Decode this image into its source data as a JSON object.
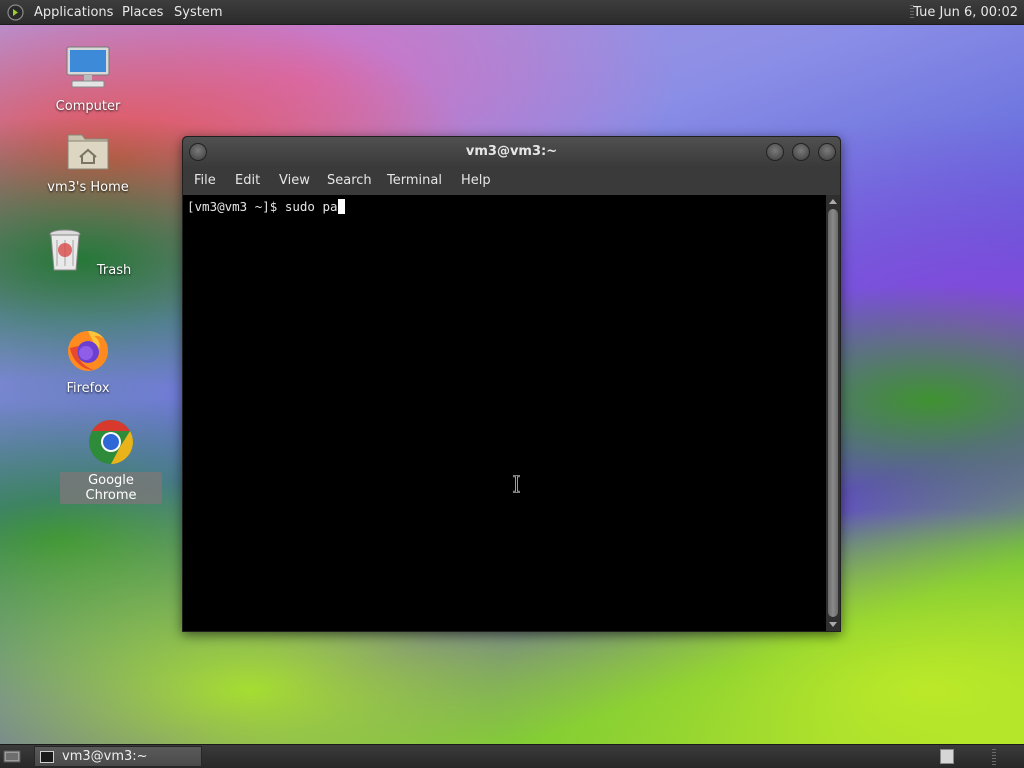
{
  "top_panel": {
    "menus": [
      "Applications",
      "Places",
      "System"
    ],
    "clock": "Tue Jun  6, 00:02"
  },
  "desktop": {
    "icons": [
      {
        "label": "Computer",
        "icon": "computer-icon"
      },
      {
        "label": "vm3's Home",
        "icon": "home-folder-icon"
      },
      {
        "label": "Trash",
        "icon": "trash-icon"
      },
      {
        "label": "Firefox",
        "icon": "firefox-icon"
      },
      {
        "label": "Google Chrome",
        "icon": "chrome-icon",
        "selected": true
      }
    ]
  },
  "terminal": {
    "title": "vm3@vm3:~",
    "menu": [
      "File",
      "Edit",
      "View",
      "Search",
      "Terminal",
      "Help"
    ],
    "prompt": "[vm3@vm3 ~]$ ",
    "typed": "sudo pa"
  },
  "bottom_panel": {
    "task_label": "vm3@vm3:~"
  }
}
